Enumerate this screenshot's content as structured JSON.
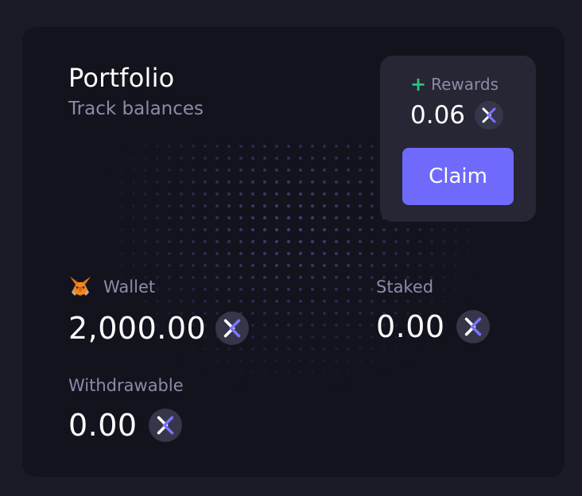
{
  "portfolio": {
    "title": "Portfolio",
    "subtitle": "Track balances"
  },
  "rewards": {
    "label": "Rewards",
    "plus_icon": "plus-icon",
    "value": "0.06",
    "token_icon": "x-token-icon",
    "claim_label": "Claim"
  },
  "wallet": {
    "icon": "metamask-fox-icon",
    "label": "Wallet",
    "value": "2,000.00",
    "token_icon": "x-token-icon"
  },
  "staked": {
    "label": "Staked",
    "value": "0.00",
    "token_icon": "x-token-icon"
  },
  "withdrawable": {
    "label": "Withdrawable",
    "value": "0.00",
    "token_icon": "x-token-icon"
  },
  "colors": {
    "background": "#1a1a27",
    "card": "#13131d",
    "rewards_box": "#262634",
    "accent": "#6f6afc",
    "plus": "#2ec27e",
    "muted_text": "#8d8aa8",
    "text": "#ffffff"
  }
}
